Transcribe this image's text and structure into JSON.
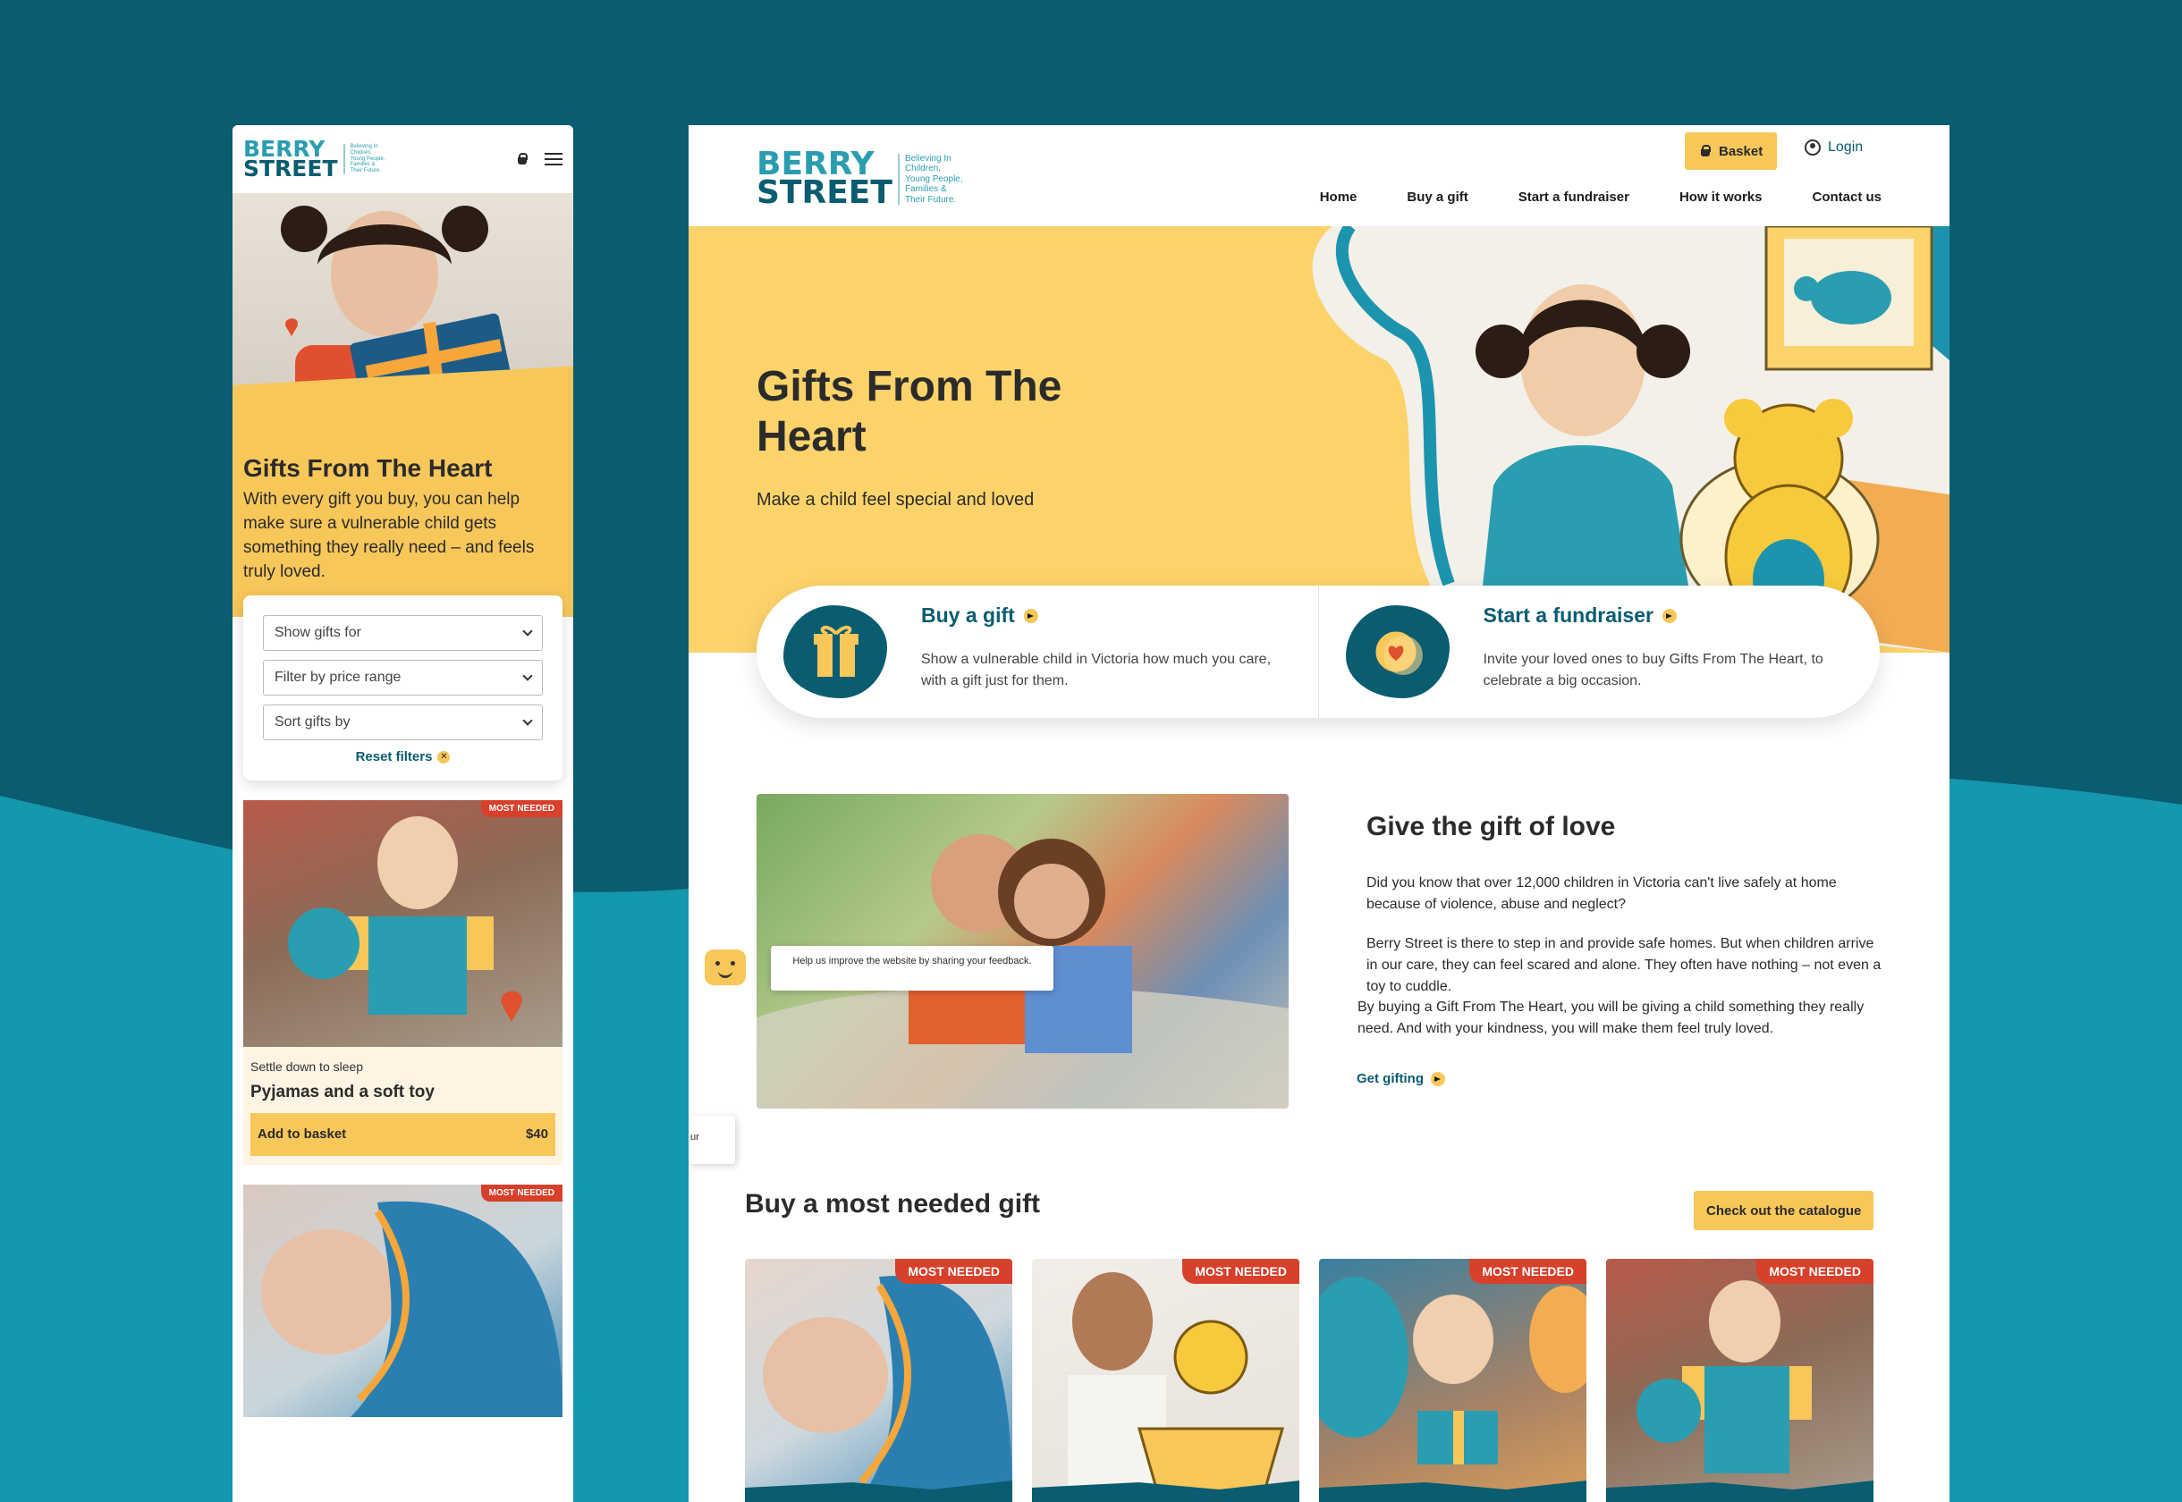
{
  "colors": {
    "brand_teal": "#0a5c70",
    "brand_light_teal": "#2a9db0",
    "accent_yellow": "#f7c75a",
    "badge_red": "#d7402b"
  },
  "logo": {
    "line1": "BERRY",
    "line2": "STREET",
    "tagline": [
      "Believing In",
      "Children,",
      "Young People,",
      "Families &",
      "Their Future."
    ]
  },
  "mobile": {
    "icons": [
      "basket-icon",
      "menu-icon"
    ],
    "hero": {
      "title": "Gifts From The Heart",
      "description": "With every gift you buy, you can help make sure a vulnerable child gets something they really need – and feels truly loved."
    },
    "filters": {
      "show_for": "Show gifts for",
      "price_range": "Filter by price range",
      "sort": "Sort gifts by",
      "reset": "Reset filters"
    },
    "cards": [
      {
        "badge": "MOST NEEDED",
        "category": "Settle down to sleep",
        "title": "Pyjamas and a soft toy",
        "add_label": "Add to basket",
        "price": "$40"
      },
      {
        "badge": "MOST NEEDED"
      }
    ]
  },
  "desktop": {
    "basket": "Basket",
    "login": "Login",
    "nav": [
      "Home",
      "Buy a gift",
      "Start a fundraiser",
      "How it works",
      "Contact us"
    ],
    "hero": {
      "title": "Gifts From The Heart",
      "subtitle": "Make a child feel special and loved"
    },
    "ctas": [
      {
        "title": "Buy a gift",
        "text": "Show a vulnerable child in Victoria how much you care, with a gift just for them.",
        "icon": "gift-icon"
      },
      {
        "title": "Start a fundraiser",
        "text": "Invite your loved ones to buy Gifts From The Heart, to celebrate a big occasion.",
        "icon": "heart-coin-icon"
      }
    ],
    "love": {
      "title": "Give the gift of love",
      "p1": "Did you know that over 12,000 children in Victoria can't live safely at home because of violence, abuse and neglect?",
      "p2": "Berry Street is there to step in and provide safe homes. But when children arrive in our care, they can feel scared and alone. They often have nothing – not even a toy to cuddle.",
      "p3": "By buying a Gift From The Heart, you will be giving a child something they really need. And with your kindness, you will make them feel truly loved.",
      "link": "Get gifting"
    },
    "feedback": {
      "tooltip": "Help us improve the website by sharing your feedback.",
      "side_tab": "ur"
    },
    "most_needed": {
      "title": "Buy a most needed gift",
      "catalogue_button": "Check out the catalogue",
      "badges": [
        "MOST NEEDED",
        "MOST NEEDED",
        "MOST NEEDED",
        "MOST NEEDED"
      ]
    }
  }
}
